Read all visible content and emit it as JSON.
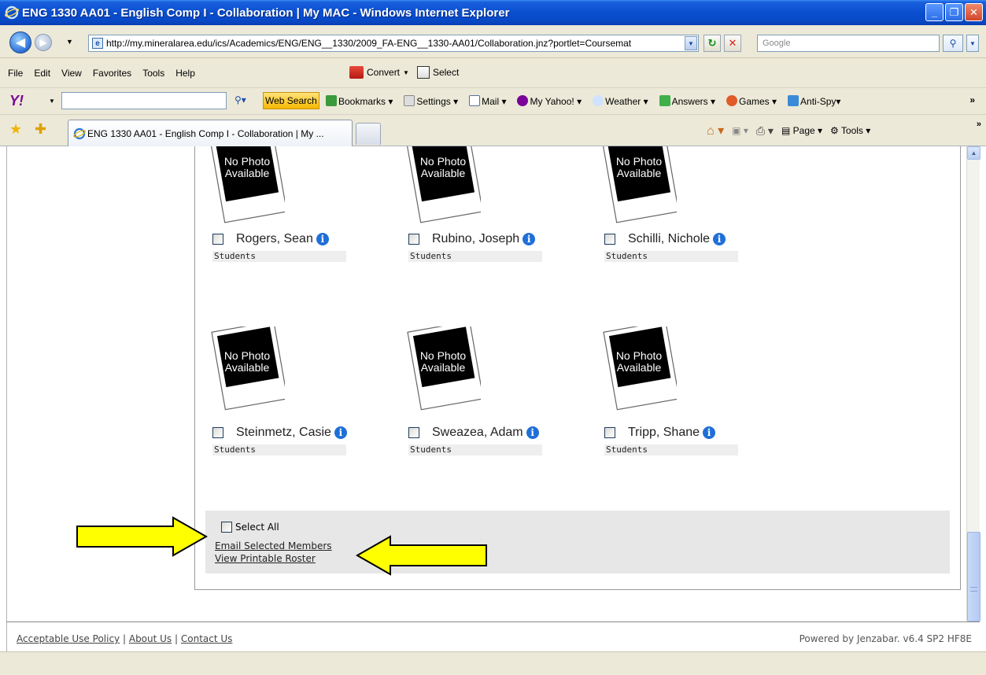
{
  "window": {
    "title": "ENG 1330 AA01 - English Comp I - Collaboration | My MAC - Windows Internet Explorer"
  },
  "address": {
    "url": "http://my.mineralarea.edu/ics/Academics/ENG/ENG__1330/2009_FA-ENG__1330-AA01/Collaboration.jnz?portlet=Coursemat"
  },
  "search": {
    "placeholder": "Google"
  },
  "menu": [
    "File",
    "Edit",
    "View",
    "Favorites",
    "Tools",
    "Help"
  ],
  "addons": {
    "convert": "Convert",
    "select": "Select"
  },
  "yahoo": {
    "web_search": "Web Search",
    "tools": [
      "Bookmarks",
      "Settings",
      "Mail",
      "My Yahoo!",
      "Weather",
      "Answers",
      "Games",
      "Anti-Spy"
    ]
  },
  "tab": {
    "title": "ENG 1330 AA01 - English Comp I - Collaboration | My ..."
  },
  "commands": {
    "page": "Page",
    "tools": "Tools"
  },
  "photo_text": {
    "line1": "No Photo",
    "line2": "Available"
  },
  "members": [
    {
      "name": "Rogers, Sean",
      "role": "Students"
    },
    {
      "name": "Rubino, Joseph",
      "role": "Students"
    },
    {
      "name": "Schilli, Nichole",
      "role": "Students"
    },
    {
      "name": "Steinmetz, Casie",
      "role": "Students"
    },
    {
      "name": "Sweazea, Adam",
      "role": "Students"
    },
    {
      "name": "Tripp, Shane",
      "role": "Students"
    }
  ],
  "actions": {
    "select_all": "Select All",
    "email_selected": "Email Selected Members",
    "printable_roster": "View Printable Roster"
  },
  "footer": {
    "links": [
      "Acceptable Use Policy",
      "About Us",
      "Contact Us"
    ],
    "separator": "|",
    "powered_by": "Powered by Jenzabar. v6.4 SP2 HF8E"
  },
  "colors": {
    "titlebar": "#0a4fd0",
    "arrow_fill": "#ffff00",
    "info_icon": "#1f6fd8"
  }
}
